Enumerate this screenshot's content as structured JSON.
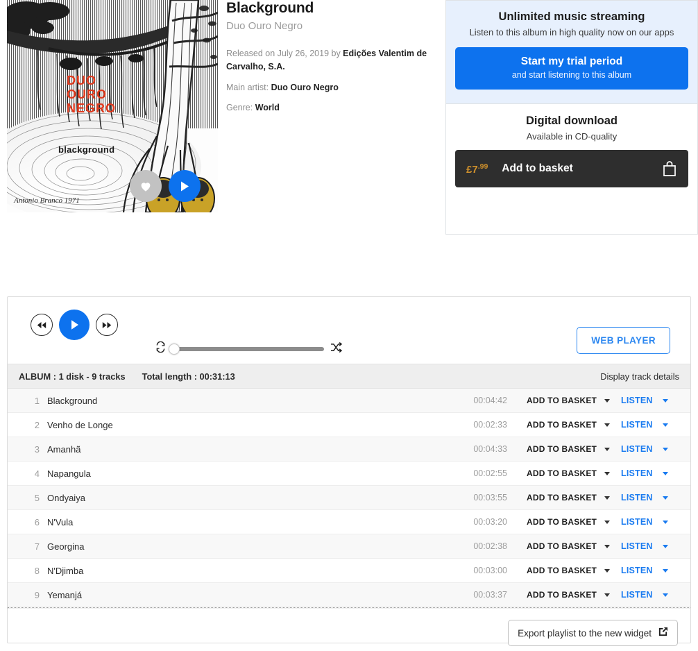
{
  "album": {
    "title": "Blackground",
    "artist": "Duo Ouro Negro",
    "released_prefix": "Released on July 26, 2019 by ",
    "label": "Edições Valentim de Carvalho, S.A.",
    "main_artist_label": "Main artist: ",
    "main_artist": "Duo Ouro Negro",
    "genre_label": "Genre: ",
    "genre": "World",
    "cover_text_artist": "DUO OURO NEGRO",
    "cover_text_title": "blackground",
    "cover_signature": "1971",
    "favorite_icon": "heart-icon",
    "play_icon": "play-icon"
  },
  "purchase": {
    "streaming_title": "Unlimited music streaming",
    "streaming_subtitle": "Listen to this album in high quality now on our apps",
    "trial_button_main": "Start my trial period",
    "trial_button_sub": "and start listening to this album",
    "download_title": "Digital download",
    "download_subtitle": "Available in CD-quality",
    "price_currency": "£",
    "price_whole": "7",
    "price_cents": ".99",
    "basket_label": "Add to basket",
    "basket_icon": "shopping-bag-icon",
    "accent_blue": "#0d72ee",
    "price_gold": "#d0912c",
    "basket_dark": "#2e2e2e",
    "stream_bg": "#e7f0fd"
  },
  "player": {
    "prev_icon": "rewind-icon",
    "play_icon": "play-icon",
    "next_icon": "fast-forward-icon",
    "repeat_icon": "repeat-icon",
    "shuffle_icon": "shuffle-icon",
    "progress_percent": 0,
    "web_player_label": "WEB PLAYER"
  },
  "tracklist_header": {
    "album_info": "ALBUM : 1 disk - 9 tracks",
    "total_length": "Total length : 00:31:13",
    "display_details": "Display track details"
  },
  "tracks": [
    {
      "num": "1",
      "title": "Blackground",
      "duration": "00:04:42",
      "basket": "ADD TO BASKET",
      "listen": "LISTEN"
    },
    {
      "num": "2",
      "title": "Venho de Longe",
      "duration": "00:02:33",
      "basket": "ADD TO BASKET",
      "listen": "LISTEN"
    },
    {
      "num": "3",
      "title": "Amanhã",
      "duration": "00:04:33",
      "basket": "ADD TO BASKET",
      "listen": "LISTEN"
    },
    {
      "num": "4",
      "title": "Napangula",
      "duration": "00:02:55",
      "basket": "ADD TO BASKET",
      "listen": "LISTEN"
    },
    {
      "num": "5",
      "title": "Ondyaiya",
      "duration": "00:03:55",
      "basket": "ADD TO BASKET",
      "listen": "LISTEN"
    },
    {
      "num": "6",
      "title": "N'Vula",
      "duration": "00:03:20",
      "basket": "ADD TO BASKET",
      "listen": "LISTEN"
    },
    {
      "num": "7",
      "title": "Georgina",
      "duration": "00:02:38",
      "basket": "ADD TO BASKET",
      "listen": "LISTEN"
    },
    {
      "num": "8",
      "title": "N'Djimba",
      "duration": "00:03:00",
      "basket": "ADD TO BASKET",
      "listen": "LISTEN"
    },
    {
      "num": "9",
      "title": "Yemanjá",
      "duration": "00:03:37",
      "basket": "ADD TO BASKET",
      "listen": "LISTEN"
    }
  ],
  "footer": {
    "export_label": "Export playlist to the new widget",
    "export_icon": "external-link-icon"
  }
}
